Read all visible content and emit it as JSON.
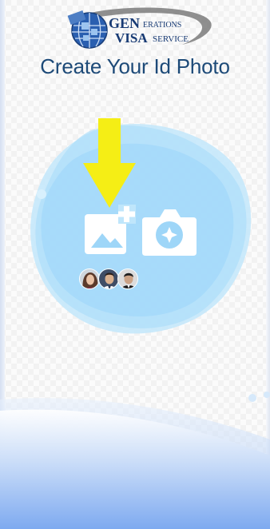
{
  "logo": {
    "gen": "GEN",
    "erations": "ERATIONS",
    "visa": "VISA",
    "service": "SERVICE"
  },
  "title": "Create Your Id Photo",
  "actions": {
    "gallery_icon": "add-photo-icon",
    "camera_icon": "camera-icon"
  },
  "colors": {
    "title": "#1d4a78",
    "blob": "#bfe6fb",
    "arrow": "#f5ee15",
    "wave": "#8fb6ef"
  },
  "avatars": [
    "woman-avatar",
    "man-avatar",
    "man-avatar"
  ]
}
